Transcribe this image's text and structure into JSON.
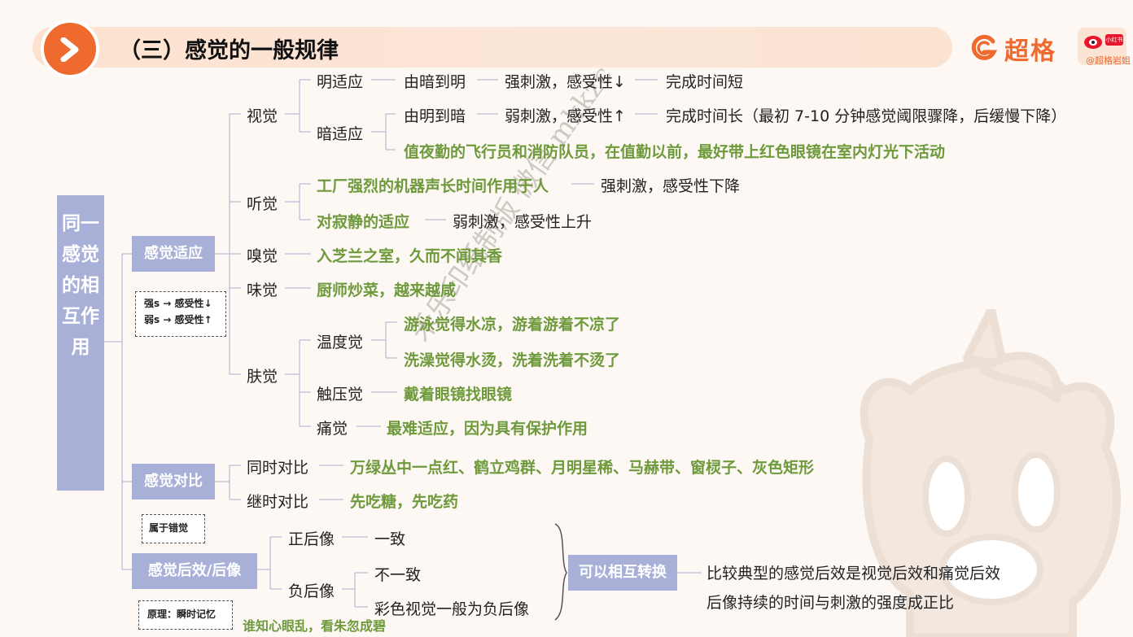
{
  "header": {
    "title": "（三）感觉的一般规律",
    "brand": "超格",
    "social_handle": "@超格岩姐",
    "social_tag": "小红书"
  },
  "colors": {
    "accent": "#ef6a2f",
    "category": "#a8b0d8",
    "highlight": "#6e9a3c"
  },
  "root": "同一感觉的相互作用",
  "watermark": {
    "line1": "禾乐印纸制版 微信 mkkzc",
    "line2": ""
  },
  "adaptation": {
    "label": "感觉适应",
    "note": [
      "强s → 感受性↓",
      "弱s → 感受性↑"
    ],
    "vision": {
      "label": "视觉",
      "light": {
        "label": "明适应",
        "a": "由暗到明",
        "b": "强刺激，感受性↓",
        "c": "完成时间短"
      },
      "dark": {
        "label": "暗适应",
        "a": "由明到暗",
        "b": "弱刺激，感受性↑",
        "c": "完成时间长（最初 7-10 分钟感觉阈限骤降，后缓慢下降）",
        "example": "值夜勤的飞行员和消防队员，在值勤以前，最好带上红色眼镜在室内灯光下活动"
      }
    },
    "hearing": {
      "label": "听觉",
      "e1": "工厂强烈的机器声长时间作用于人",
      "r1": "强刺激，感受性下降",
      "e2": "对寂静的适应",
      "r2": "弱刺激，感受性上升"
    },
    "smell": {
      "label": "嗅觉",
      "example": "入芝兰之室，久而不闻其香"
    },
    "taste": {
      "label": "味觉",
      "example": "厨师炒菜，越来越咸"
    },
    "skin": {
      "label": "肤觉",
      "temp": {
        "label": "温度觉",
        "e1": "游泳觉得水凉，游着游着不凉了",
        "e2": "洗澡觉得水烫，洗着洗着不烫了"
      },
      "touch": {
        "label": "触压觉",
        "example": "戴着眼镜找眼镜"
      },
      "pain": {
        "label": "痛觉",
        "example": "最难适应，因为具有保护作用"
      }
    }
  },
  "contrast": {
    "label": "感觉对比",
    "note": "属于错觉",
    "simultaneous": {
      "label": "同时对比",
      "example": "万绿丛中一点红、鹤立鸡群、月明星稀、马赫带、窗棂子、灰色矩形"
    },
    "successive": {
      "label": "继时对比",
      "example": "先吃糖，先吃药"
    }
  },
  "afterimage": {
    "label": "感觉后效/后像",
    "note": "原理：瞬时记忆",
    "poem": "谁知心眼乱，看朱忽成碧",
    "positive": {
      "label": "正后像",
      "desc": "一致"
    },
    "negative": {
      "label": "负后像",
      "desc": "不一致",
      "desc2": "彩色视觉一般为负后像"
    },
    "convert": "可以相互转换",
    "summary1": "比较典型的感觉后效是视觉后效和痛觉后效",
    "summary2": "后像持续的时间与刺激的强度成正比"
  }
}
